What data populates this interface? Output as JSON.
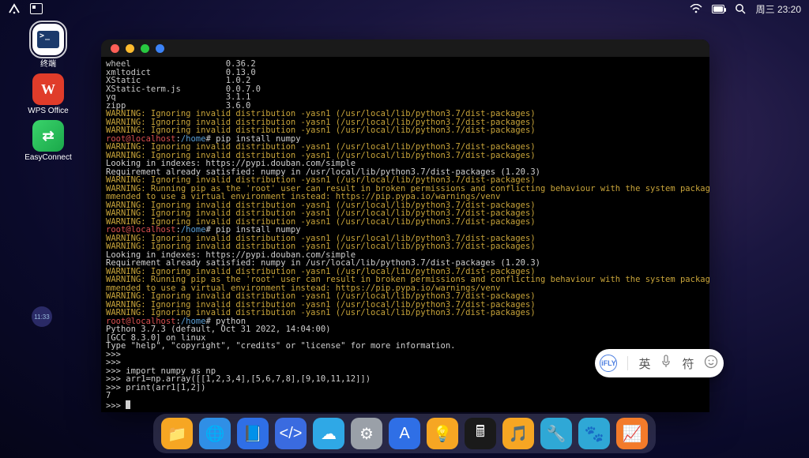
{
  "menubar": {
    "time": "周三 23:20"
  },
  "side_apps": [
    {
      "name": "terminal",
      "label": "终端",
      "selected": true
    },
    {
      "name": "wps",
      "label": "WPS Office",
      "glyph": "W"
    },
    {
      "name": "easyconnect",
      "label": "EasyConnect",
      "glyph": "⇄"
    }
  ],
  "floating_badge": "11:33",
  "terminal": {
    "packages": [
      [
        "wheel",
        "0.36.2"
      ],
      [
        "xmltodict",
        "0.13.0"
      ],
      [
        "XStatic",
        "1.0.2"
      ],
      [
        "XStatic-term.js",
        "0.0.7.0"
      ],
      [
        "yq",
        "3.1.1"
      ],
      [
        "zipp",
        "3.6.0"
      ]
    ],
    "warn": "WARNING: Ignoring invalid distribution -yasn1 (/usr/local/lib/python3.7/dist-packages)",
    "root_warn": "WARNING: Running pip as the 'root' user can result in broken permissions and conflicting behaviour with the system package manager. It is reco",
    "root_warn2": "mmended to use a virtual environment instead: https://pip.pypa.io/warnings/venv",
    "prompt_user": "root@localhost",
    "prompt_path": "/home",
    "hash": "#",
    "cmd1": "pip install numpy",
    "index_line": "Looking in indexes: https://pypi.douban.com/simple",
    "req_line": "Requirement already satisfied: numpy in /usr/local/lib/python3.7/dist-packages (1.20.3)",
    "cmd2": "pip install numpy",
    "cmd3": "python",
    "py_header": "Python 3.7.3 (default, Oct 31 2022, 14:04:00)",
    "py_gcc": "[GCC 8.3.0] on linux",
    "py_help": "Type \"help\", \"copyright\", \"credits\" or \"license\" for more information.",
    "pyrepl": [
      ">>> ",
      ">>> ",
      ">>> import numpy as np",
      ">>> arr1=np.array([[1,2,3,4],[5,6,7,8],[9,10,11,12]])",
      ">>> print(arr1[1,2])",
      "7",
      ">>> "
    ]
  },
  "ime": {
    "logo": "iFLY",
    "lang": "英",
    "sym": "符"
  },
  "dock": [
    {
      "name": "files",
      "glyph": "📁"
    },
    {
      "name": "browser",
      "glyph": "🌐"
    },
    {
      "name": "editor",
      "glyph": "📘"
    },
    {
      "name": "code",
      "glyph": "</>"
    },
    {
      "name": "cloud",
      "glyph": "☁"
    },
    {
      "name": "settings",
      "glyph": "⚙"
    },
    {
      "name": "appstore",
      "glyph": "A"
    },
    {
      "name": "tips",
      "glyph": "💡"
    },
    {
      "name": "calculator",
      "glyph": "🖩"
    },
    {
      "name": "music",
      "glyph": "🎵"
    },
    {
      "name": "tools",
      "glyph": "🔧"
    },
    {
      "name": "chat",
      "glyph": "🐾"
    },
    {
      "name": "monitor",
      "glyph": "📈"
    }
  ]
}
